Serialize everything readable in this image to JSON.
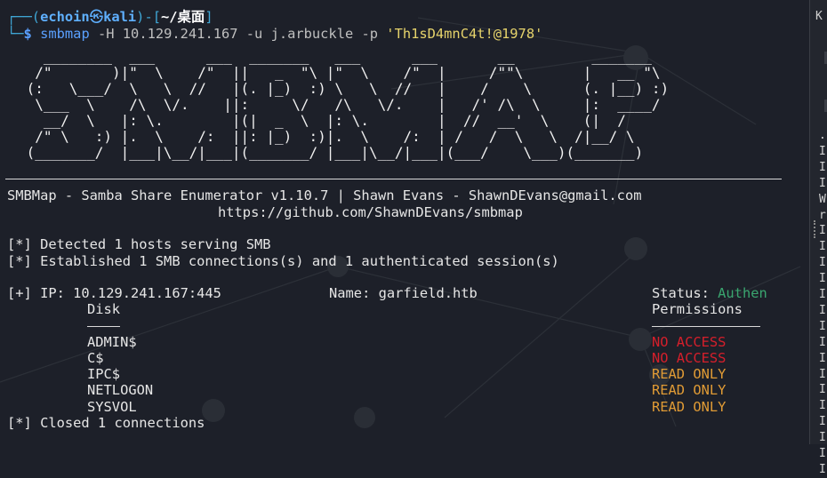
{
  "prompt": {
    "corner_top": "┌──(",
    "user": "echoin",
    "at_symbol": "㉿",
    "host": "kali",
    "sep": ")-[",
    "dir": "~/桌面",
    "close": "]",
    "corner_bottom": "└─",
    "dollar": "$",
    "command_name": "smbmap",
    "command_args": " -H 10.129.241.167 -u j.arbuckle -p ",
    "password_arg": "'Th1sD4mnC4t!@1978'"
  },
  "banner": {
    "ascii_art": "   ________  ___      ___  _______   ___      ___       __         _______\n  /\"       )|\"  \\    /\"  ||   _  \"\\ |\"  \\    /\"  |     /\"\"\\       |   __ \"\\\n (:   \\___/  \\   \\  //   |(. |_)  :) \\   \\  //   |    /    \\      (. |__) :)\n  \\___  \\    /\\  \\/.    ||:     \\/   /\\   \\/.    |   /' /\\  \\     |:  ____/\n   __/  \\   |: \\.        |(|  _  \\  |: \\.        |  //  __'  \\    (|  /\n  /\" \\   :) |.  \\    /:  ||: |_)  :)|.  \\    /:  | /   /  \\   \\  /|__/ \\\n (_______/  |___|\\__/|___|(_______/ |___|\\__/|___|(___/    \\___)(_______)",
    "tagline": "SMBMap - Samba Share Enumerator v1.10.7 | Shawn Evans - ShawnDEvans@gmail.com",
    "url": "https://github.com/ShawnDEvans/smbmap"
  },
  "output": {
    "detected": "[*] Detected 1 hosts serving SMB",
    "established": "[*] Established 1 SMB connections(s) and 1 authenticated session(s)",
    "ip_line_prefix": "[+] IP: 10.129.241.167:445",
    "name_label": "Name: garfield.htb",
    "status_label": "Status: ",
    "status_value": "Authen",
    "disk_header": "Disk",
    "permissions_header": "Permissions",
    "shares": [
      {
        "name": "ADMIN$",
        "perm": "NO ACCESS"
      },
      {
        "name": "C$",
        "perm": "NO ACCESS"
      },
      {
        "name": "IPC$",
        "perm": "READ ONLY"
      },
      {
        "name": "NETLOGON",
        "perm": "READ ONLY"
      },
      {
        "name": "SYSVOL",
        "perm": "READ ONLY"
      }
    ],
    "closed": "[*] Closed 1 connections"
  },
  "sidepanel": {
    "top_letter": "K",
    "rows": [
      ".",
      "I",
      "I",
      "I",
      "W",
      "r",
      "I",
      "I",
      "I",
      "I",
      "I",
      "I",
      "I",
      "I",
      "I",
      "I",
      "I",
      "I",
      "I",
      "I",
      "I",
      "I"
    ]
  },
  "colors": {
    "background": "#1d2029",
    "prompt_cyan": "#3fa7d6",
    "no_access_red": "#d61f2b",
    "read_only_orange": "#e09b35",
    "status_green": "#3aa56f"
  }
}
